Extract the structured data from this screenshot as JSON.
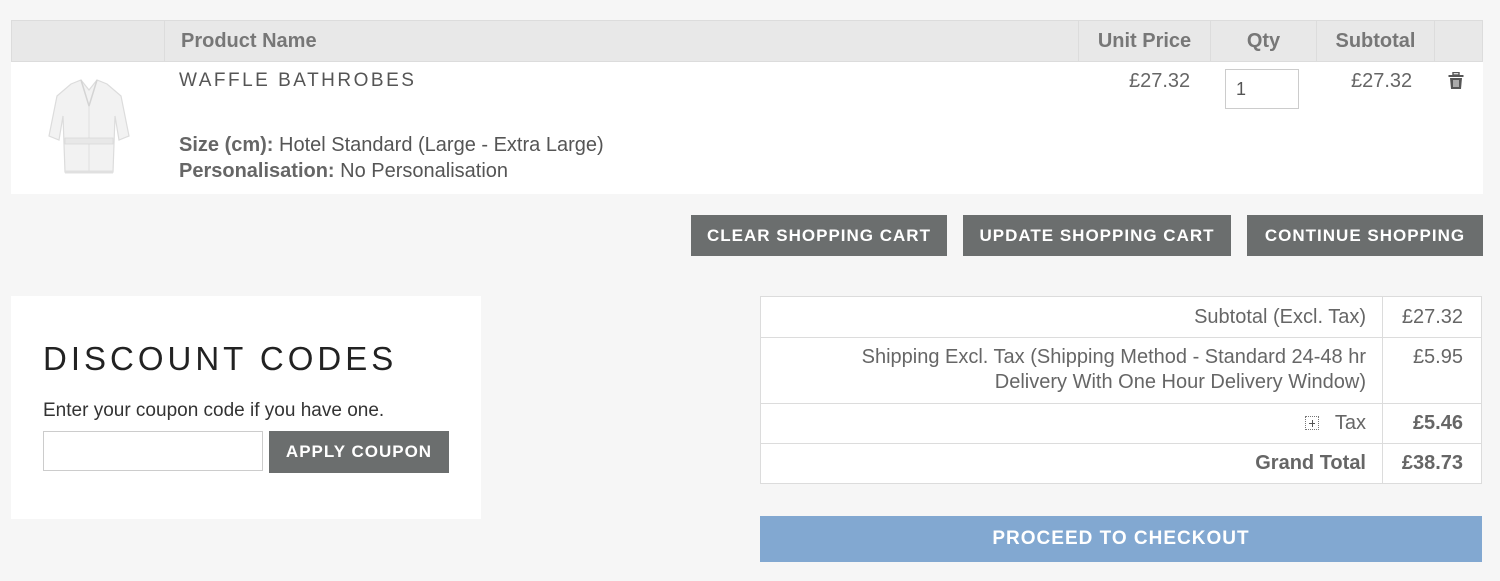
{
  "cart": {
    "columns": {
      "product_name": "Product Name",
      "unit_price": "Unit Price",
      "qty": "Qty",
      "subtotal": "Subtotal"
    },
    "items": [
      {
        "name": "WAFFLE BATHROBES",
        "options": [
          {
            "label": "Size (cm):",
            "value": "Hotel Standard (Large - Extra Large)"
          },
          {
            "label": "Personalisation:",
            "value": "No Personalisation"
          }
        ],
        "unit_price": "£27.32",
        "qty": "1",
        "subtotal": "£27.32"
      }
    ]
  },
  "actions": {
    "clear": "CLEAR SHOPPING CART",
    "update": "UPDATE SHOPPING CART",
    "continue": "CONTINUE SHOPPING"
  },
  "discount": {
    "title": "DISCOUNT CODES",
    "instruction": "Enter your coupon code if you have one.",
    "coupon_value": "",
    "apply_label": "APPLY COUPON"
  },
  "totals": {
    "subtotal_label": "Subtotal (Excl. Tax)",
    "subtotal_value": "£27.32",
    "shipping_label_line1": "Shipping Excl. Tax (Shipping Method - Standard 24-48 hr",
    "shipping_label_line2": "Delivery With One Hour Delivery Window)",
    "shipping_value": "£5.95",
    "tax_label": "Tax",
    "tax_value": "£5.46",
    "grand_total_label": "Grand Total",
    "grand_total_value": "£38.73"
  },
  "checkout_label": "PROCEED TO CHECKOUT",
  "colors": {
    "button_gray": "#6b6e6e",
    "checkout_blue": "#82a8d1",
    "page_bg": "#f6f6f6"
  }
}
